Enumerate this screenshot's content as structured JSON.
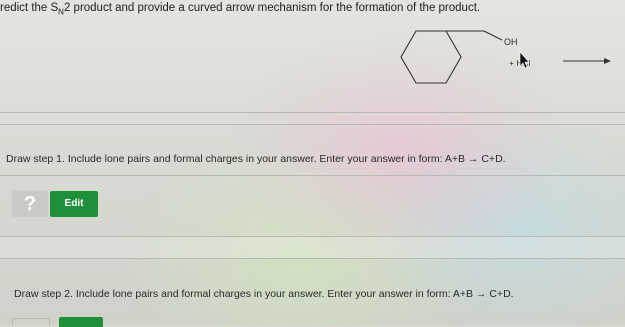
{
  "question": {
    "prefix": "redict the S",
    "subscript": "N",
    "suffix": "2 product and provide a curved arrow mechanism for the formation of the product."
  },
  "molecule": {
    "oh_label": "OH",
    "reagent_label": "+ HCl"
  },
  "step1": {
    "prompt": "Draw step 1. Include lone pairs and formal charges in your answer. Enter your answer in form: A+B → C+D.",
    "help_icon": "?",
    "edit_label": "Edit"
  },
  "step2": {
    "prompt": "Draw step 2. Include lone pairs and formal charges in your answer. Enter your answer in form: A+B → C+D."
  }
}
